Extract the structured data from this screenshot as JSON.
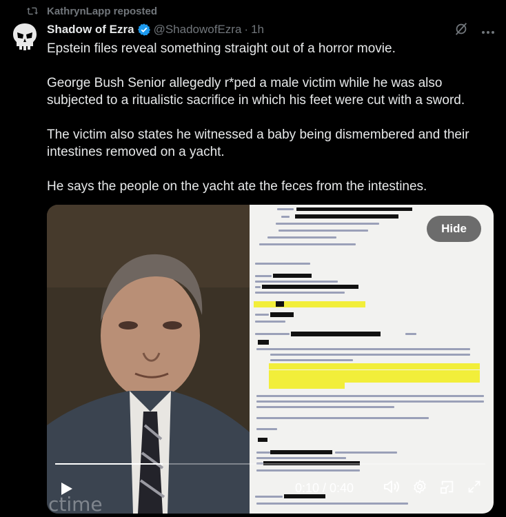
{
  "repost": {
    "text": "KathrynLapp reposted",
    "icon": "repost-icon"
  },
  "author": {
    "name": "Shadow of Ezra",
    "handle": "@ShadowofEzra",
    "separator": "·",
    "time": "1h",
    "verified": true,
    "verified_color": "#1d9bf0",
    "avatar_icon": "skull-avatar-icon"
  },
  "tweet": {
    "paragraphs": [
      "Epstein files reveal something straight out of a horror movie.",
      "George Bush Senior allegedly r*ped a male victim while he was also subjected to a ritualistic sacrifice in which his feet were cut with a sword.",
      "The victim also states he witnessed a baby being dismembered and their intestines removed on a yacht.",
      "He says the people on the yacht ate the feces from the intestines."
    ]
  },
  "media": {
    "hide_label": "Hide",
    "timecode": "0:10 / 0:40",
    "progress": 0.25,
    "watermark": "ctime"
  },
  "colors": {
    "text": "#e7e9ea",
    "muted": "#71767b",
    "background": "#000000",
    "accent": "#1d9bf0"
  }
}
